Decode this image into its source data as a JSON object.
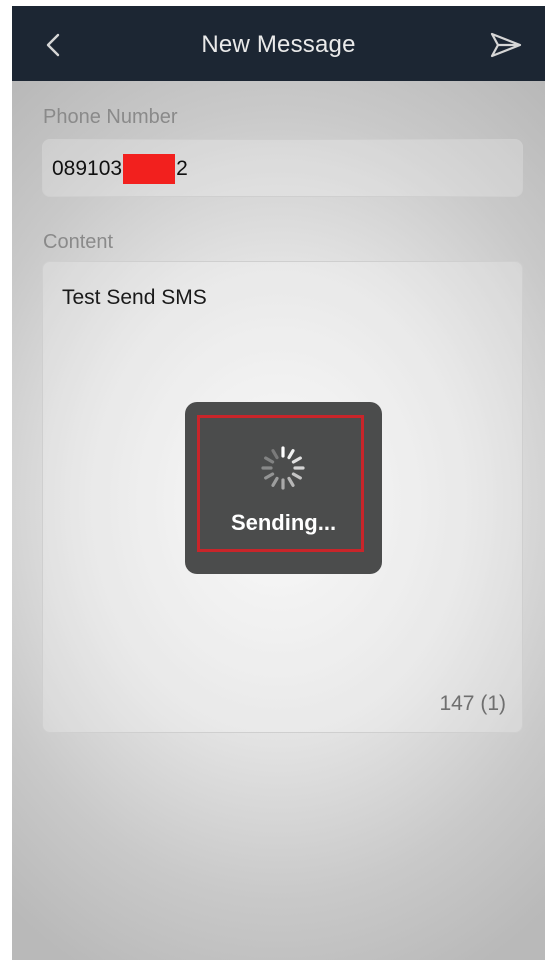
{
  "navbar": {
    "title": "New Message",
    "back_icon": "chevron-left-icon",
    "send_icon": "send-icon",
    "background": "#1c2633"
  },
  "phone_field": {
    "label": "Phone Number",
    "value_prefix": "089103",
    "value_suffix": "2"
  },
  "content_field": {
    "label": "Content",
    "value": "Test Send SMS",
    "counter": "147 (1)"
  },
  "hud": {
    "text": "Sending...",
    "icon": "spinner-icon",
    "highlight_color": "#c9252a"
  }
}
